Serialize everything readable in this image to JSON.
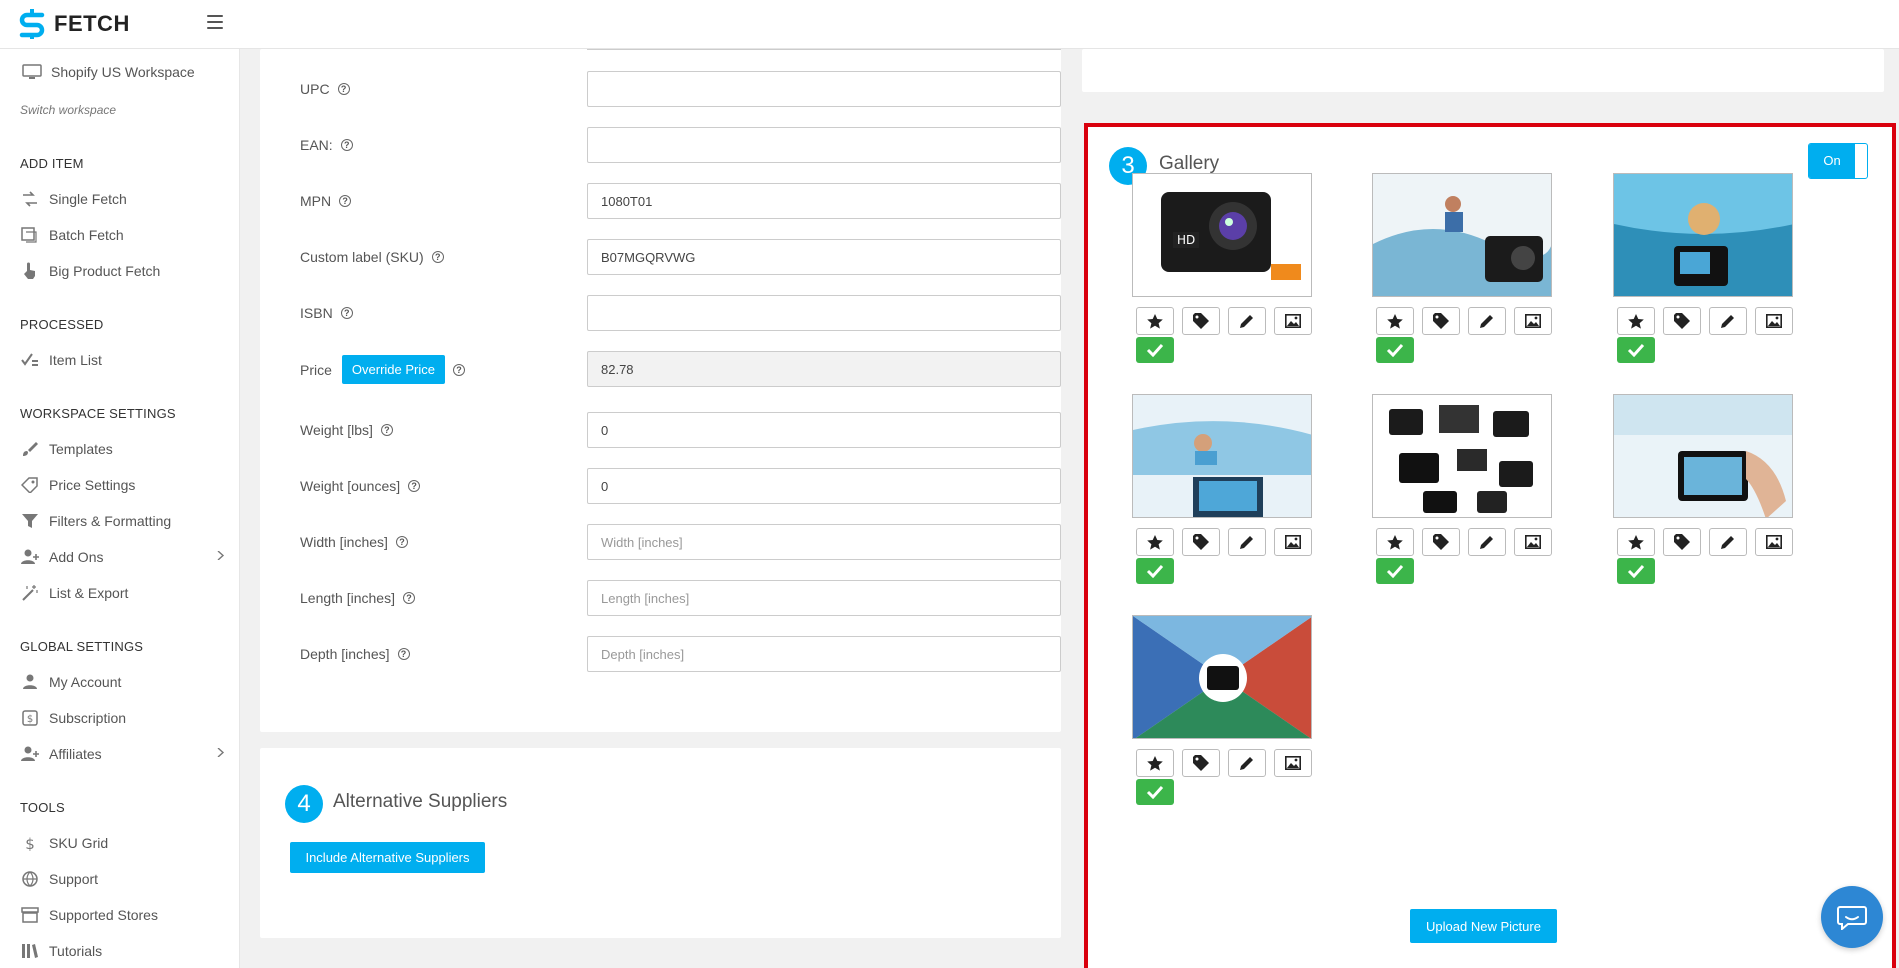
{
  "app": {
    "logo_text": "FETCH"
  },
  "sidebar": {
    "workspace": "Shopify US Workspace",
    "switch_label": "Switch workspace",
    "sections": {
      "add_item": "ADD ITEM",
      "processed": "PROCESSED",
      "workspace_settings": "WORKSPACE SETTINGS",
      "global_settings": "GLOBAL SETTINGS",
      "tools": "TOOLS"
    },
    "items": {
      "single_fetch": "Single Fetch",
      "batch_fetch": "Batch Fetch",
      "big_product_fetch": "Big Product Fetch",
      "item_list": "Item List",
      "templates": "Templates",
      "price_settings": "Price Settings",
      "filters_formatting": "Filters & Formatting",
      "add_ons": "Add Ons",
      "list_export": "List & Export",
      "my_account": "My Account",
      "subscription": "Subscription",
      "affiliates": "Affiliates",
      "sku_grid": "SKU Grid",
      "support": "Support",
      "supported_stores": "Supported Stores",
      "tutorials": "Tutorials"
    }
  },
  "form": {
    "upc": {
      "label": "UPC",
      "value": ""
    },
    "ean": {
      "label": "EAN:",
      "value": ""
    },
    "mpn": {
      "label": "MPN",
      "value": "1080T01"
    },
    "sku": {
      "label": "Custom label (SKU)",
      "value": "B07MGQRVWG"
    },
    "isbn": {
      "label": "ISBN",
      "value": ""
    },
    "price": {
      "label": "Price",
      "override_label": "Override Price",
      "value": "82.78"
    },
    "weight_lbs": {
      "label": "Weight [lbs]",
      "value": "0"
    },
    "weight_oz": {
      "label": "Weight [ounces]",
      "value": "0"
    },
    "width": {
      "label": "Width [inches]",
      "placeholder": "Width [inches]"
    },
    "length": {
      "label": "Length [inches]",
      "placeholder": "Length [inches]"
    },
    "depth": {
      "label": "Depth [inches]",
      "placeholder": "Depth [inches]"
    },
    "help_glyph": "?"
  },
  "alt_suppliers": {
    "step": "4",
    "title": "Alternative Suppliers",
    "button": "Include Alternative Suppliers"
  },
  "gallery": {
    "step": "3",
    "title": "Gallery",
    "toggle": "On",
    "upload_button": "Upload New Picture",
    "image_count": 7
  },
  "colors": {
    "accent": "#00aeef",
    "success": "#3cb54a",
    "highlight": "#d9000d"
  }
}
